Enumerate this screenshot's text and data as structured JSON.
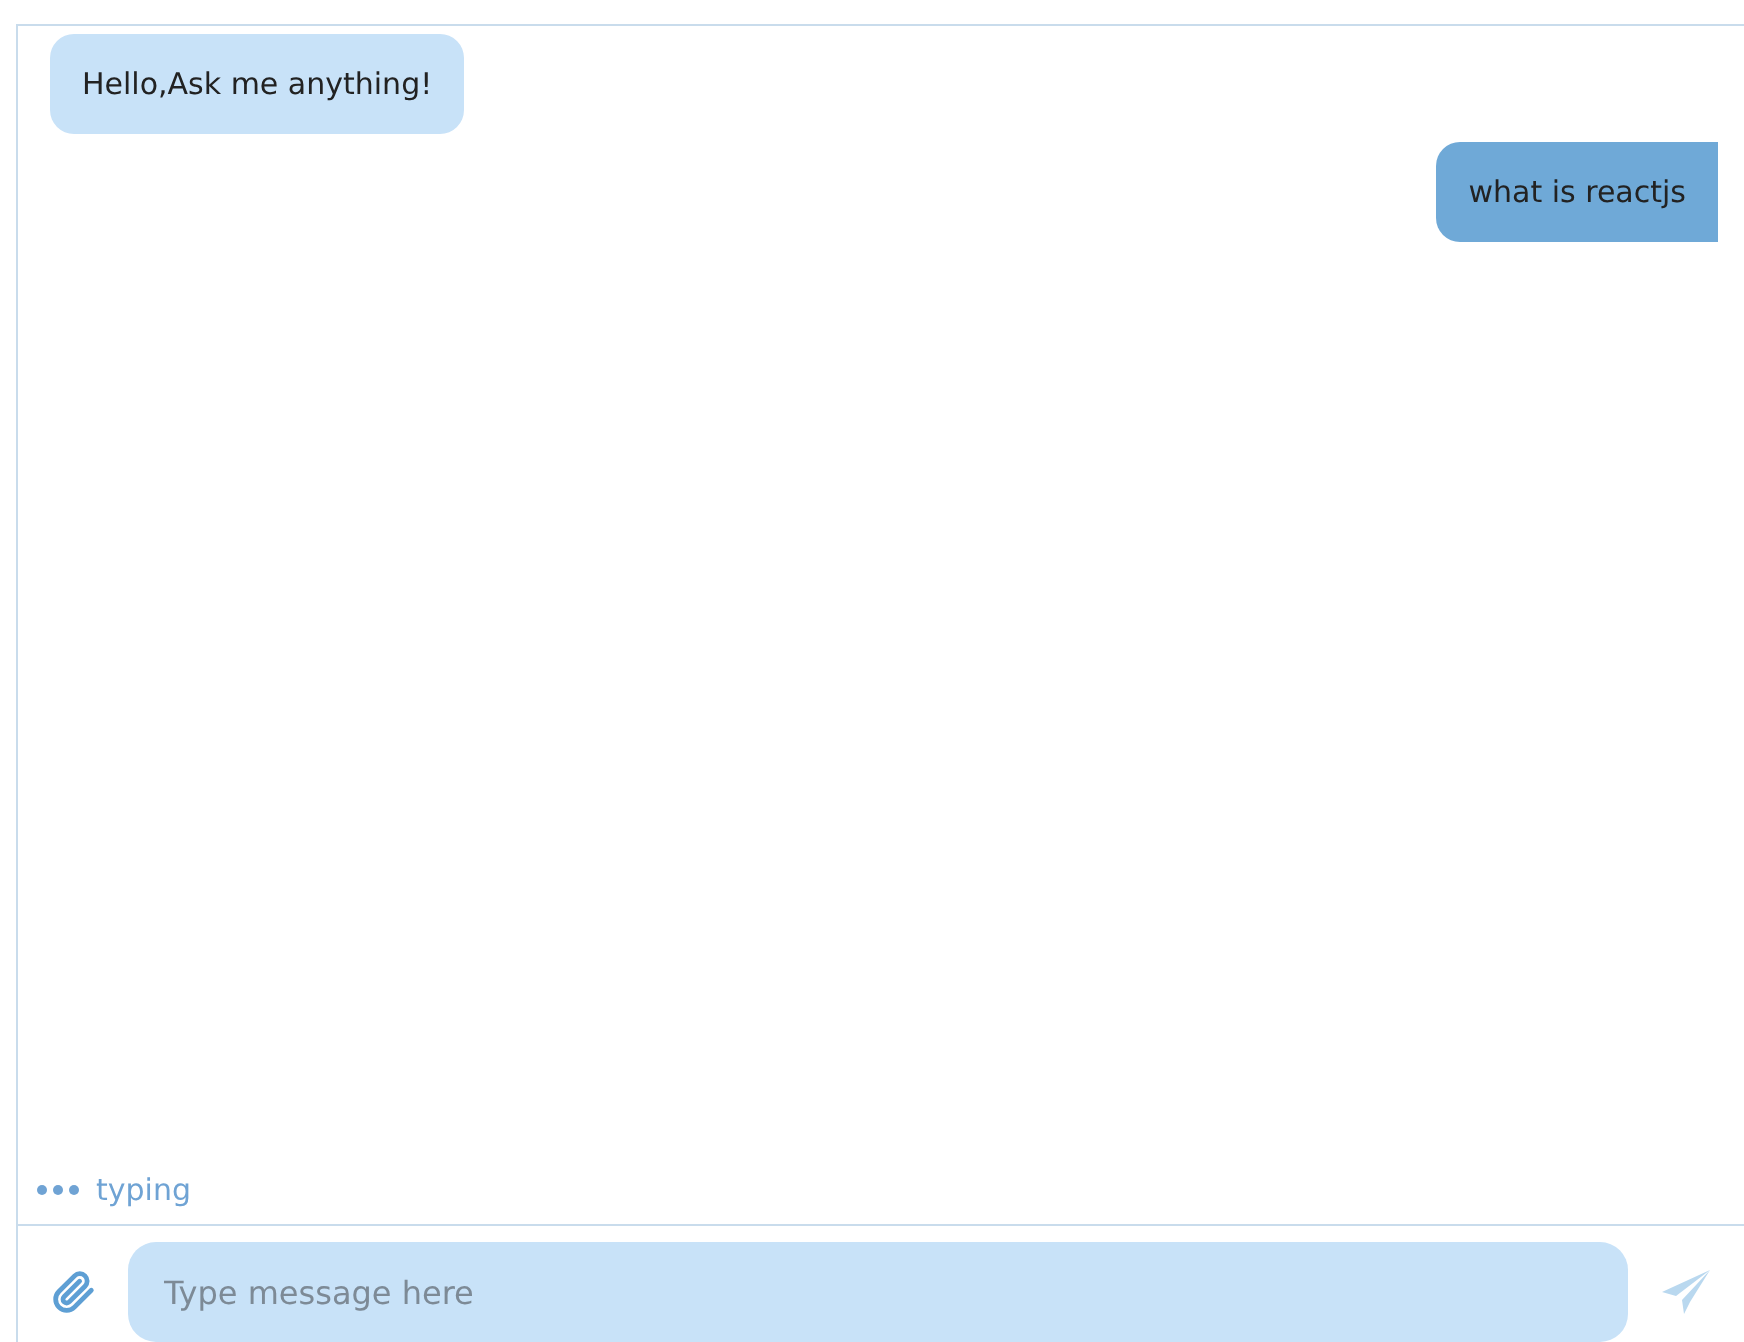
{
  "messages": [
    {
      "kind": "received",
      "text": "Hello,Ask me anything!"
    },
    {
      "kind": "sent",
      "text": "what is reactjs"
    }
  ],
  "typing_indicator": {
    "label": "typing"
  },
  "composer": {
    "placeholder": "Type message here"
  }
}
